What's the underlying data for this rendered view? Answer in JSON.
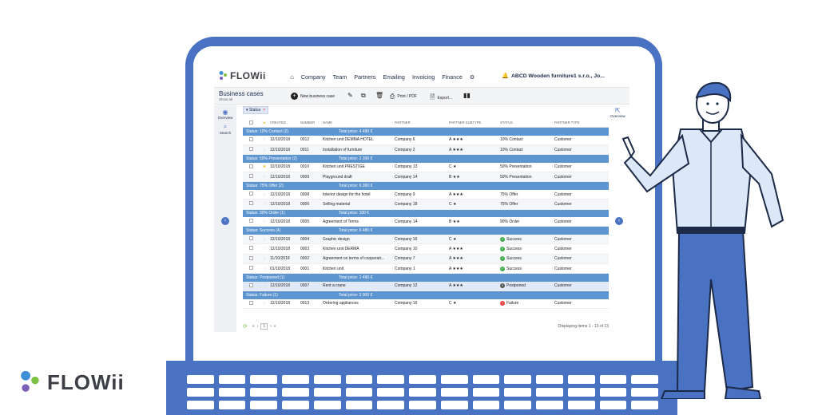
{
  "brand": {
    "name": "FLOWii",
    "colors": {
      "blue": "#3d8fd6",
      "green": "#7cc243",
      "purple": "#7a5fb5",
      "dark": "#3c3f46"
    }
  },
  "app": {
    "logo": "FLOWii",
    "nav": [
      "Company",
      "Team",
      "Partners",
      "Emailing",
      "Invoicing",
      "Finance"
    ],
    "company_name": "ABCD Wooden furniture1 s.r.o., Jo...",
    "toolbar": {
      "title": "Business cases",
      "show_all": "Show all",
      "new_case": "New business case",
      "print": "Print / PDF",
      "export": "Export..."
    },
    "sidebar": {
      "overview": "Overview",
      "search": "Search"
    },
    "overview_right": "Overview",
    "filter_chip": "Status",
    "columns": [
      "CREATED",
      "NUMBER",
      "NAME",
      "PARTNER",
      "PARTNER SUBTYPE",
      "STATUS",
      "PARTNER TYPE"
    ],
    "groups": [
      {
        "label": "Status: 10% Contact (2)",
        "total": "Total price: 4 490 €",
        "rows": [
          {
            "starred": false,
            "created": "12/10/2018",
            "number": "0012",
            "name": "Kitchen unit DEMMA HOTEL",
            "partner": "Company 6",
            "subtype": "A ★★★",
            "status": "10% Contact",
            "status_icon": "",
            "ptype": "Customer"
          },
          {
            "starred": false,
            "created": "12/10/2018",
            "number": "0011",
            "name": "Installation of furniture",
            "partner": "Company 2",
            "subtype": "A ★★★",
            "status": "10% Contact",
            "status_icon": "",
            "ptype": "Customer"
          }
        ]
      },
      {
        "label": "Status: 50% Presentation (2)",
        "total": "Total price: 2 390 €",
        "rows": [
          {
            "starred": true,
            "created": "12/10/2018",
            "number": "0010",
            "name": "Kitchen unit PRESTIGE",
            "partner": "Company 13",
            "subtype": "C ★",
            "status": "50% Presentation",
            "status_icon": "",
            "ptype": "Customer"
          },
          {
            "starred": false,
            "created": "12/10/2018",
            "number": "0009",
            "name": "Playground draft",
            "partner": "Company 14",
            "subtype": "B ★★",
            "status": "50% Presentation",
            "status_icon": "",
            "ptype": "Customer"
          }
        ]
      },
      {
        "label": "Status: 75% Offer (2)",
        "total": "Total price: 6 390 €",
        "rows": [
          {
            "starred": false,
            "created": "12/10/2018",
            "number": "0008",
            "name": "Interior design for the hotel",
            "partner": "Company 9",
            "subtype": "A ★★★",
            "status": "75% Offer",
            "status_icon": "",
            "ptype": "Customer"
          },
          {
            "starred": false,
            "created": "12/10/2018",
            "number": "0006",
            "name": "Selling material",
            "partner": "Company 18",
            "subtype": "C ★",
            "status": "75% Offer",
            "status_icon": "",
            "ptype": "Customer"
          }
        ]
      },
      {
        "label": "Status: 90% Order (1)",
        "total": "Total price: 100 €",
        "rows": [
          {
            "starred": false,
            "created": "12/10/2018",
            "number": "0005",
            "name": "Agreement of Terms",
            "partner": "Company 14",
            "subtype": "B ★★",
            "status": "90% Order",
            "status_icon": "",
            "ptype": "Customer"
          }
        ]
      },
      {
        "label": "Status: Success (4)",
        "total": "Total price: 6 480 €",
        "rows": [
          {
            "starred": false,
            "created": "12/10/2018",
            "number": "0004",
            "name": "Graphic design",
            "partner": "Company 16",
            "subtype": "C ★",
            "status": "Success",
            "status_icon": "success",
            "ptype": "Customer"
          },
          {
            "starred": false,
            "created": "12/10/2018",
            "number": "0003",
            "name": "Kitchen unit DERMA",
            "partner": "Company 10",
            "subtype": "A ★★★",
            "status": "Success",
            "status_icon": "success",
            "ptype": "Customer"
          },
          {
            "starred": false,
            "created": "11/10/2018",
            "number": "0002",
            "name": "Agreement on terms of cooperati...",
            "partner": "Company 7",
            "subtype": "A ★★★",
            "status": "Success",
            "status_icon": "success",
            "ptype": "Customer"
          },
          {
            "starred": false,
            "created": "01/10/2018",
            "number": "0001",
            "name": "Kitchen unit",
            "partner": "Company 1",
            "subtype": "A ★★★",
            "status": "Success",
            "status_icon": "success",
            "ptype": "Customer"
          }
        ]
      },
      {
        "label": "Status: Postponed (1)",
        "total": "Total price: 1 490 €",
        "rows": [
          {
            "starred": false,
            "created": "12/10/2018",
            "number": "0007",
            "name": "Rent a crane",
            "partner": "Company 12",
            "subtype": "A ★★★",
            "status": "Postponed",
            "status_icon": "postponed",
            "ptype": "Customer",
            "selected": true
          }
        ]
      },
      {
        "label": "Status: Failure (1)",
        "total": "Total price: 2 000 €",
        "rows": [
          {
            "starred": false,
            "created": "12/10/2018",
            "number": "0013",
            "name": "Ordering appliances",
            "partner": "Company 16",
            "subtype": "C ★",
            "status": "Failure",
            "status_icon": "failure",
            "ptype": "Customer"
          }
        ]
      }
    ],
    "pager": {
      "page": "1",
      "displaying": "Displaying items 1 - 13 of 13"
    }
  },
  "brand_bottom": "FLOWii"
}
